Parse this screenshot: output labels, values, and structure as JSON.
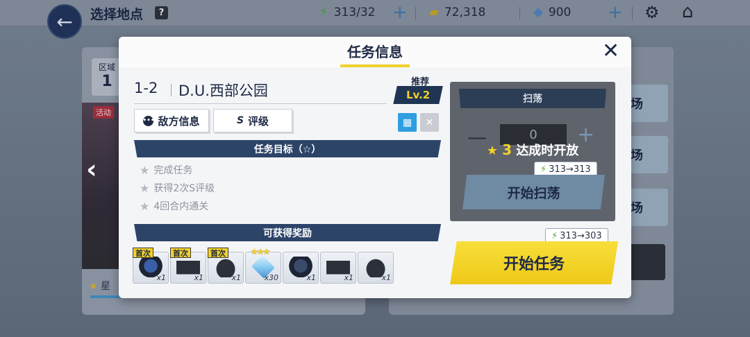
{
  "topbar": {
    "title": "选择地点",
    "help": "?",
    "energy": "313/32",
    "gold": "72,318",
    "gems": "900",
    "plus": "+"
  },
  "background": {
    "zone_label": "区域",
    "zone_number": "1",
    "event_tag": "活动",
    "star_label": "星",
    "right_items": [
      "场",
      "场",
      "场"
    ]
  },
  "modal": {
    "title": "任务信息",
    "close": "✕",
    "stage_id": "1-2",
    "stage_name": "D.U.西部公园",
    "recommend_label": "推荐",
    "recommend_level": "Lv.2",
    "tabs": {
      "enemy_info": "敌方信息",
      "rating_icon": "S",
      "rating": "评级"
    },
    "objectives_header": "任务目标（☆）",
    "objectives": [
      "完成任务",
      "获得2次S评级",
      "4回合内通关"
    ],
    "rewards_header": "可获得奖励",
    "first_tag": "首次",
    "rewards": [
      {
        "icon": "gloves-icon",
        "qty": "x1",
        "first": true
      },
      {
        "icon": "bag-icon",
        "qty": "x1",
        "first": true
      },
      {
        "icon": "cap-icon",
        "qty": "x1",
        "first": true
      },
      {
        "icon": "crystal-icon",
        "qty": "x30",
        "rarity": "★★★"
      },
      {
        "icon": "gloves-icon",
        "qty": "x1"
      },
      {
        "icon": "bag-icon",
        "qty": "x1"
      },
      {
        "icon": "cap-icon",
        "qty": "x1"
      }
    ],
    "sweep": {
      "header": "扫荡",
      "count": "0",
      "minus": "—",
      "plus": "+",
      "unlock_star": "★",
      "unlock_num": "3",
      "unlock_text": "达成时开放",
      "energy_cost": "313→313",
      "button": "开始扫荡"
    },
    "start": {
      "energy_cost": "313→303",
      "button": "开始任务"
    }
  },
  "colors": {
    "accent_yellow": "#f2d12a",
    "navy": "#2c4468",
    "energy_green": "#4da83a"
  }
}
